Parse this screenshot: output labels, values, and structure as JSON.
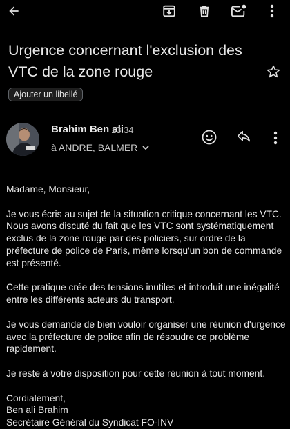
{
  "toolbar": {
    "back": "arrow-back-icon",
    "archive": "archive-icon",
    "delete": "delete-icon",
    "mark_unread": "mark-unread-icon",
    "more": "more-vert-icon"
  },
  "email": {
    "subject": "Urgence concernant l'exclusion des VTC de la zone rouge",
    "label_button": "Ajouter un libellé",
    "sender": "Brahim Ben ali",
    "time": "13:34",
    "recipients": "à ANDRE, BALMER",
    "body": {
      "greeting": "Madame, Monsieur,",
      "p1": "Je vous écris au sujet de la situation critique concernant les VTC. Nous avons discuté du fait que les VTC sont systématiquement exclus de la zone rouge par des policiers, sur ordre de la préfecture de police de Paris, même lorsqu'un bon de commande est présenté.",
      "p2": "Cette pratique crée des tensions inutiles et introduit une inégalité entre les différents acteurs du transport.",
      "p3": "Je vous demande de bien vouloir organiser une réunion d'urgence avec la préfecture de police afin de résoudre ce problème rapidement.",
      "p4": "Je reste à votre disposition pour cette réunion à tout moment.",
      "closing": "Cordialement,",
      "sig_name": "Ben ali Brahim",
      "sig_title": "Secrétaire Général du Syndicat FO-INV"
    }
  },
  "colors": {
    "background": "#000000",
    "text": "#e3e3e3",
    "muted": "#b8b8b8"
  }
}
